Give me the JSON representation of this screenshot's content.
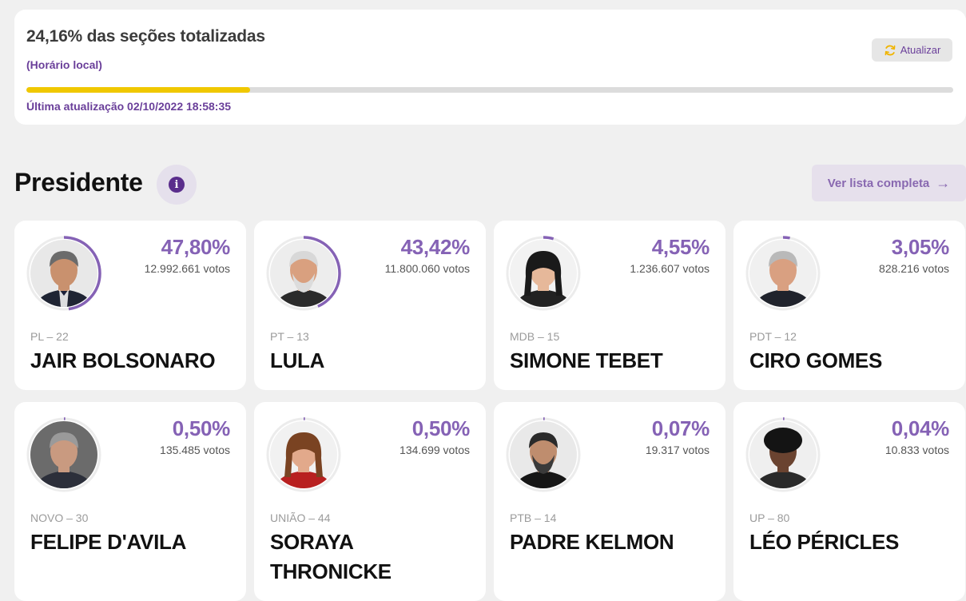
{
  "status": {
    "title": "24,16% das seções totalizadas",
    "subtitle": "(Horário local)",
    "refresh_label": "Atualizar",
    "progress": 0.2416,
    "last_update": "Última atualização 02/10/2022 18:58:35"
  },
  "section": {
    "title": "Presidente",
    "info_icon": "i",
    "view_all_label": "Ver lista completa",
    "view_all_arrow": "→"
  },
  "colors": {
    "accent": "#8562b5",
    "accent_dark": "#5a2d8c",
    "progress_fill": "#f0c800",
    "ring_track": "#ececec"
  },
  "candidates": [
    {
      "party": "PL – 22",
      "name": "JAIR BOLSONARO",
      "percent": "47,80%",
      "share": 0.478,
      "votes": "12.992.661 votos",
      "photo": {
        "bg": "#e8e8e8",
        "skin": "#c9916e",
        "hair": "#6b6b6b",
        "shirt": "#1f2433",
        "tie": true
      }
    },
    {
      "party": "PT – 13",
      "name": "LULA",
      "percent": "43,42%",
      "share": 0.4342,
      "votes": "11.800.060 votos",
      "photo": {
        "bg": "#ededed",
        "skin": "#d9a07f",
        "hair": "#d8d8d8",
        "shirt": "#2b2b2b",
        "beard": "#dcdcdc"
      }
    },
    {
      "party": "MDB – 15",
      "name": "SIMONE TEBET",
      "percent": "4,55%",
      "share": 0.0455,
      "votes": "1.236.607 votos",
      "photo": {
        "bg": "#f2f2f2",
        "skin": "#e6b89a",
        "hair": "#1a1a1a",
        "shirt": "#222222",
        "long_hair": true
      }
    },
    {
      "party": "PDT – 12",
      "name": "CIRO GOMES",
      "percent": "3,05%",
      "share": 0.0305,
      "votes": "828.216 votos",
      "photo": {
        "bg": "#f0f0f0",
        "skin": "#d9a081",
        "hair": "#b9b9b9",
        "shirt": "#20232c"
      }
    },
    {
      "party": "NOVO – 30",
      "name": "FELIPE D'AVILA",
      "percent": "0,50%",
      "share": 0.005,
      "votes": "135.485 votos",
      "photo": {
        "bg": "#6b6b6b",
        "skin": "#c99a80",
        "hair": "#9a9a9a",
        "shirt": "#2c2f3a"
      }
    },
    {
      "party": "UNIÃO – 44",
      "name": "SORAYA THRONICKE",
      "percent": "0,50%",
      "share": 0.005,
      "votes": "134.699 votos",
      "photo": {
        "bg": "#f1f1f1",
        "skin": "#e2a98b",
        "hair": "#7a4322",
        "shirt": "#b82020",
        "long_hair": true
      }
    },
    {
      "party": "PTB – 14",
      "name": "PADRE KELMON",
      "percent": "0,07%",
      "share": 0.0007,
      "votes": "19.317 votos",
      "photo": {
        "bg": "#e9e9e9",
        "skin": "#bf8d6e",
        "hair": "#2a2a2a",
        "shirt": "#161616",
        "beard": "#3a3a3a"
      }
    },
    {
      "party": "UP – 80",
      "name": "LÉO PÉRICLES",
      "percent": "0,04%",
      "share": 0.0004,
      "votes": "10.833 votos",
      "photo": {
        "bg": "#efefef",
        "skin": "#6a4330",
        "hair": "#141414",
        "shirt": "#2a2a2a",
        "curly": true
      }
    }
  ]
}
